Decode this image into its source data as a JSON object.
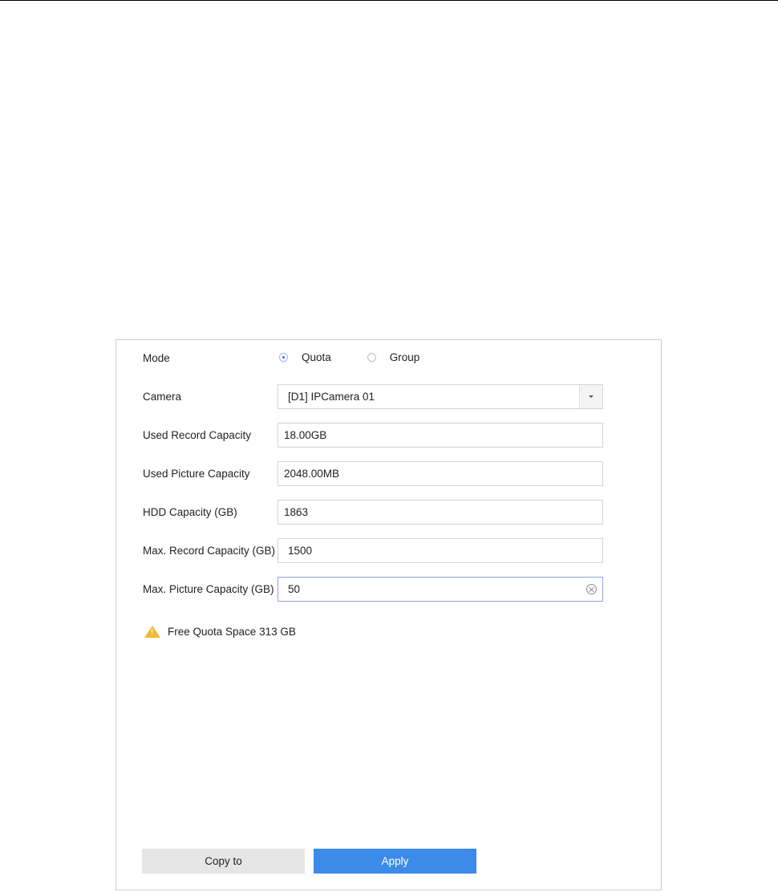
{
  "form": {
    "mode_label": "Mode",
    "mode_options": [
      {
        "label": "Quota",
        "selected": true
      },
      {
        "label": "Group",
        "selected": false
      }
    ],
    "camera_label": "Camera",
    "camera_value": "[D1] IPCamera 01",
    "used_record_label": "Used Record Capacity",
    "used_record_value": "18.00GB",
    "used_picture_label": "Used Picture Capacity",
    "used_picture_value": "2048.00MB",
    "hdd_label": "HDD Capacity (GB)",
    "hdd_value": "1863",
    "max_record_label": "Max. Record Capacity (GB)",
    "max_record_value": "1500",
    "max_picture_label": "Max. Picture Capacity (GB)",
    "max_picture_value": "50"
  },
  "warning": {
    "text": "Free Quota Space 313 GB",
    "icon": "warning-icon",
    "color": "#f4b731"
  },
  "buttons": {
    "copy_label": "Copy to",
    "apply_label": "Apply"
  },
  "colors": {
    "accent": "#3c8be9",
    "radio_selected": "#2f6fe0"
  }
}
